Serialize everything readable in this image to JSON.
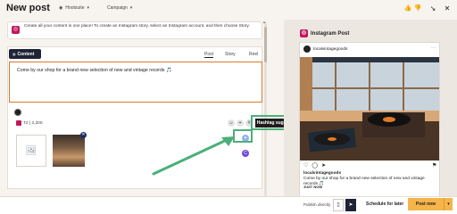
{
  "header": {
    "title": "New post",
    "org_label": "Hootsuite",
    "campaign_label": "Campaign"
  },
  "info": {
    "text": "Create all your content in one place! To create an Instagram story, select an Instagram account, and then choose Story."
  },
  "editor": {
    "content_tab": "Content",
    "tabs": [
      "Post",
      "Story",
      "Reel"
    ],
    "text": "Come by our shop for a brand new selection of new and vintage records 🎵",
    "char_count": "T2 | 2,200"
  },
  "tooltip": {
    "text": "Hashtag suggestions"
  },
  "preview": {
    "title": "Instagram Post",
    "username": "localvintagegoods",
    "caption_user": "localvintagegoods",
    "caption": "Come by our shop for a brand new selection of new and vintage records 🎵",
    "time": "JUST NOW"
  },
  "footer": {
    "publish_label": "Publish directly",
    "schedule_label": "Schedule for later",
    "post_now_label": "Post now"
  },
  "colors": {
    "accent": "#f5b54a",
    "instagram": "#c2185b",
    "navy": "#1e2336",
    "highlight": "#4caf7a"
  }
}
